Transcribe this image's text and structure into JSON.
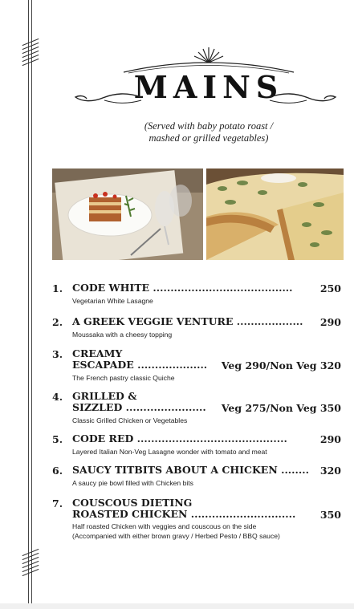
{
  "heading": {
    "title": "MAINS",
    "subtitle_line1": "(Served with baby potato roast /",
    "subtitle_line2": "mashed or grilled vegetables)"
  },
  "images": [
    {
      "name": "lasagne-photo",
      "description": "vegetarian lasagne"
    },
    {
      "name": "quiche-photo",
      "description": "quiche"
    }
  ],
  "items": [
    {
      "number": "1.",
      "name_line1": "CODE WHITE ........................................",
      "name_line2": "",
      "price": "250",
      "desc_line1": "Vegetarian White Lasagne",
      "desc_line2": ""
    },
    {
      "number": "2.",
      "name_line1": "A GREEK VEGGIE VENTURE ...................",
      "name_line2": "",
      "price": "290",
      "desc_line1": "Moussaka with a cheesy topping",
      "desc_line2": ""
    },
    {
      "number": "3.",
      "name_line1": "CREAMY",
      "name_line2": "ESCAPADE ....................",
      "price": "Veg 290/Non Veg 320",
      "desc_line1": "The French pastry classic Quiche",
      "desc_line2": ""
    },
    {
      "number": "4.",
      "name_line1": "GRILLED &",
      "name_line2": "SIZZLED .......................",
      "price": "Veg 275/Non Veg 350",
      "desc_line1": "Classic Grilled Chicken or Vegetables",
      "desc_line2": ""
    },
    {
      "number": "5.",
      "name_line1": "CODE RED ...........................................",
      "name_line2": "",
      "price": "290",
      "desc_line1": "Layered Italian Non-Veg Lasagne wonder with tomato and meat",
      "desc_line2": ""
    },
    {
      "number": "6.",
      "name_line1": "SAUCY TITBITS ABOUT A CHICKEN ........",
      "name_line2": "",
      "price": "320",
      "desc_line1": "A saucy pie bowl filled with Chicken bits",
      "desc_line2": ""
    },
    {
      "number": "7.",
      "name_line1": "COUSCOUS DIETING",
      "name_line2": "ROASTED CHICKEN ..............................",
      "price": "350",
      "desc_line1": "Half roasted Chicken with veggies and couscous on the side",
      "desc_line2": "(Accompanied with either brown gravy / Herbed Pesto / BBQ sauce)"
    }
  ]
}
